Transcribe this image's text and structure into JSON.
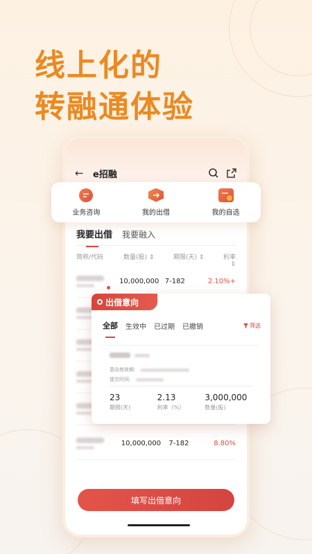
{
  "headline": {
    "line1": "线上化的",
    "line2": "转融通体验"
  },
  "app": {
    "title": "e招融"
  },
  "quick_actions": [
    {
      "label": "业务咨询",
      "icon": "chat-icon"
    },
    {
      "label": "我的出借",
      "icon": "lend-icon"
    },
    {
      "label": "我的自选",
      "icon": "favorites-icon"
    }
  ],
  "tabs": [
    {
      "label": "我要出借"
    },
    {
      "label": "我要融入"
    }
  ],
  "table": {
    "headers": [
      "简称/代码",
      "数量(股) ⇕",
      "期限(天) ⇕",
      "利率 ⇕"
    ],
    "rows": [
      {
        "quantity": "10,000,000",
        "term": "7-182",
        "rate": "2.10%+"
      },
      {
        "quantity": "",
        "term": "",
        "rate": ""
      },
      {
        "quantity": "",
        "term": "",
        "rate": ""
      },
      {
        "quantity": "",
        "term": "",
        "rate": ""
      },
      {
        "quantity": "",
        "term": "",
        "rate": ""
      },
      {
        "quantity": "10,000,000",
        "term": "7-182",
        "rate": "8.80%"
      }
    ]
  },
  "cta": {
    "label": "填写出借意向"
  },
  "intent_panel": {
    "title": "出借意向",
    "tabs": [
      "全部",
      "生效中",
      "已过期",
      "已撤销"
    ],
    "filter_label": "筛选",
    "card": {
      "validity_label": "意向有效期:",
      "submit_label": "提交时间:",
      "stats": [
        {
          "value": "23",
          "label": "期限(天)"
        },
        {
          "value": "2.13",
          "label": "利率（%）"
        },
        {
          "value": "3,000,000",
          "label": "数量(股)"
        }
      ]
    }
  },
  "colors": {
    "accent_orange": "#ea8a22",
    "brand_red": "#d9473c"
  }
}
